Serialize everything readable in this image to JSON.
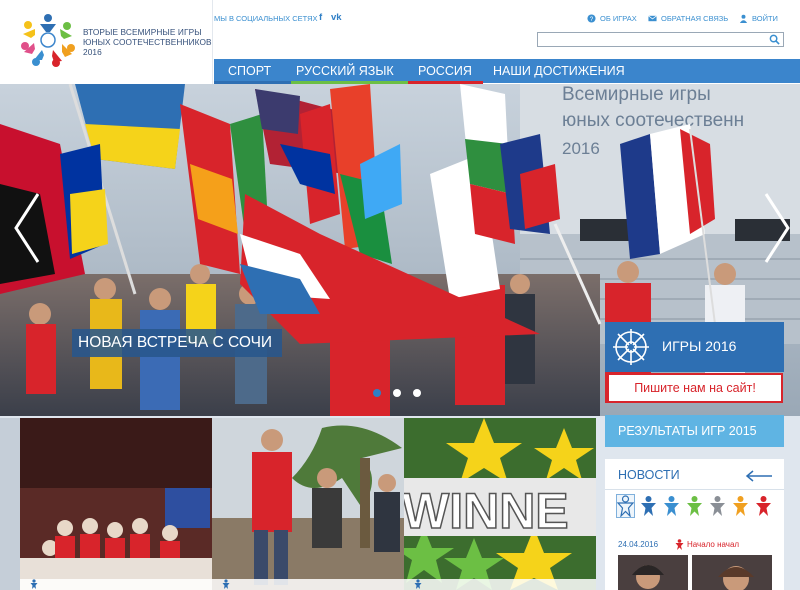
{
  "header": {
    "logo_lines": [
      "Вторые Всемирные игры",
      "юных соотечественников",
      "2016"
    ],
    "social_label": "Мы в социальных сетях",
    "social_icons": [
      {
        "name": "facebook-icon",
        "glyph": "f"
      },
      {
        "name": "vk-icon",
        "glyph": "vk"
      }
    ],
    "links": [
      {
        "label": "Об играх",
        "icon": "question-icon"
      },
      {
        "label": "Обратная связь",
        "icon": "mail-icon"
      },
      {
        "label": "Войти",
        "icon": "user-icon"
      }
    ],
    "search": {
      "value": "",
      "placeholder": "",
      "icon": "search-icon"
    }
  },
  "nav": {
    "items": [
      {
        "label": "Спорт",
        "underline": "#2e6fb3"
      },
      {
        "label": "Русский язык",
        "underline": "#6cbf44"
      },
      {
        "label": "Россия",
        "underline": "#d8242b"
      },
      {
        "label": "Наши достижения",
        "underline": "#3b85cc"
      }
    ]
  },
  "hero": {
    "caption": "Новая встреча с Сочи",
    "backdrop_text": [
      "Всемирные игры",
      "юных соотечественн",
      "2016"
    ],
    "slides_count": 3,
    "active_slide": 0,
    "prev_icon": "chevron-left-icon",
    "next_icon": "chevron-right-icon"
  },
  "sidebar": {
    "games_label": "Игры 2016",
    "games_icon": "wheel-emblem-icon",
    "write_button": "Пишите нам на сайт!",
    "results_label": "Результаты игр 2015",
    "news": {
      "title": "Новости",
      "nav_icon": "arrow-left-icon",
      "figure_colors": [
        "#2e6fb3",
        "#2e6fb3",
        "#3a8fd0",
        "#6cbf44",
        "#8a8f96",
        "#f0a020",
        "#d8242b"
      ],
      "date": "24.04.2016",
      "tag": "Начало начал",
      "tag_icon": "figure-icon"
    }
  },
  "tiles": [
    {
      "name": "tile-concert"
    },
    {
      "name": "tile-planting"
    },
    {
      "name": "tile-winner",
      "text": "WINNE"
    }
  ],
  "colors": {
    "primary": "#3b85cc",
    "dark_blue": "#2e6fb3",
    "light_blue": "#5fb4e3",
    "red": "#d8242b",
    "green": "#6cbf44"
  }
}
